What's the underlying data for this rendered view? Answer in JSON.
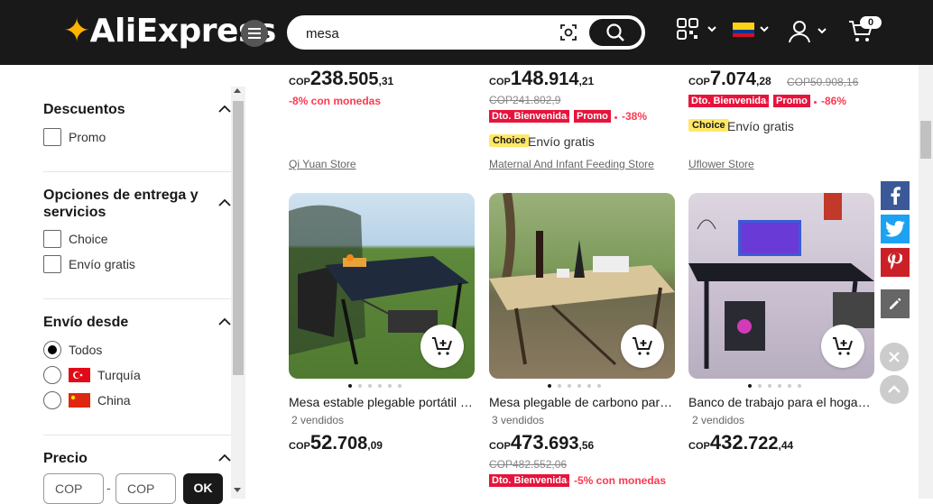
{
  "header": {
    "logo": "AliExpress",
    "search_value": "mesa",
    "cart_count": "0"
  },
  "filters": {
    "discounts": {
      "title": "Descuentos",
      "options": [
        "Promo"
      ]
    },
    "delivery": {
      "title": "Opciones de entrega y servicios",
      "options": [
        "Choice",
        "Envío gratis"
      ]
    },
    "ships_from": {
      "title": "Envío desde",
      "options": [
        "Todos",
        "Turquía",
        "China"
      ],
      "selected": "Todos"
    },
    "price": {
      "title": "Precio",
      "min_placeholder": "COP",
      "max_placeholder": "COP",
      "separator": "-",
      "ok_label": "OK"
    }
  },
  "top_row": [
    {
      "cur": "COP",
      "big": "238",
      "mid": ".505",
      "dec": ",31",
      "red": "-8% con monedas",
      "store": "Qi Yuan Store"
    },
    {
      "cur": "COP",
      "big": "148",
      "mid": ".914",
      "dec": ",21",
      "strike": "COP241.802,9",
      "tag1": "Dto. Bienvenida",
      "tag2": "Promo",
      "red": "-38%",
      "choice": "Choice",
      "ship": "Envío gratis",
      "store": "Maternal And Infant Feeding Store"
    },
    {
      "cur": "COP",
      "big": "7",
      "mid": ".074",
      "dec": ",28",
      "strike": "COP50.908,16",
      "tag1": "Dto. Bienvenida",
      "tag2": "Promo",
      "red": "-86%",
      "choice": "Choice",
      "ship": "Envío gratis",
      "store": "Uflower Store"
    }
  ],
  "products": [
    {
      "title": "Mesa estable plegable portátil para exteriores",
      "sold": "2 vendidos",
      "cur": "COP",
      "big": "52",
      "mid": ".708",
      "dec": ",09"
    },
    {
      "title": "Mesa plegable de carbono para acampar",
      "sold": "3 vendidos",
      "cur": "COP",
      "big": "473",
      "mid": ".693",
      "dec": ",56",
      "strike": "COP482.552,06",
      "tag1": "Dto. Bienvenida",
      "red": "-5% con monedas"
    },
    {
      "title": "Banco de trabajo para el hogar escritorio",
      "sold": "2 vendidos",
      "cur": "COP",
      "big": "432",
      "mid": ".722",
      "dec": ",44"
    }
  ],
  "colors": {
    "accent": "#fd384f",
    "topbar": "#191919",
    "choice": "#ffe866"
  }
}
